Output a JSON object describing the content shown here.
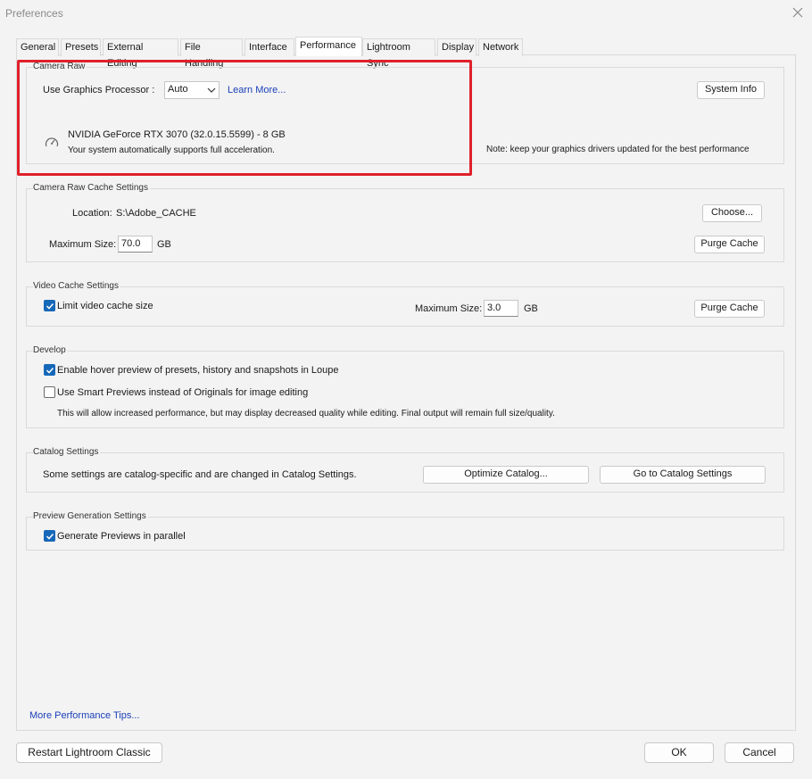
{
  "window": {
    "title": "Preferences"
  },
  "tabs": [
    {
      "label": "General"
    },
    {
      "label": "Presets"
    },
    {
      "label": "External Editing"
    },
    {
      "label": "File Handling"
    },
    {
      "label": "Interface"
    },
    {
      "label": "Performance"
    },
    {
      "label": "Lightroom Sync"
    },
    {
      "label": "Display"
    },
    {
      "label": "Network"
    }
  ],
  "camera_raw": {
    "legend": "Camera Raw",
    "gpu_label": "Use Graphics Processor :",
    "gpu_value": "Auto",
    "learn_more": "Learn More...",
    "system_info": "System Info",
    "gpu_name": "NVIDIA GeForce RTX 3070 (32.0.15.5599) - 8 GB",
    "gpu_status": "Your system automatically supports full acceleration.",
    "note": "Note: keep your graphics drivers updated for the best performance"
  },
  "cache": {
    "legend": "Camera Raw Cache Settings",
    "location_label": "Location:",
    "location_value": "S:\\Adobe_CACHE",
    "choose": "Choose...",
    "max_label": "Maximum Size:",
    "max_value": "70.0",
    "unit": "GB",
    "purge": "Purge Cache"
  },
  "video_cache": {
    "legend": "Video Cache Settings",
    "limit_label": "Limit video cache size",
    "limit_checked": true,
    "max_label": "Maximum Size:",
    "max_value": "3.0",
    "unit": "GB",
    "purge": "Purge Cache"
  },
  "develop": {
    "legend": "Develop",
    "hover_label": "Enable hover preview of presets, history and snapshots in Loupe",
    "hover_checked": true,
    "smart_label": "Use Smart Previews instead of Originals for image editing",
    "smart_checked": false,
    "smart_note": "This will allow increased performance, but may display decreased quality while editing. Final output will remain full size/quality."
  },
  "catalog": {
    "legend": "Catalog Settings",
    "text": "Some settings are catalog-specific and are changed in Catalog Settings.",
    "optimize": "Optimize Catalog...",
    "goto": "Go to Catalog Settings"
  },
  "preview": {
    "legend": "Preview Generation Settings",
    "parallel_label": "Generate Previews in parallel",
    "parallel_checked": true
  },
  "footer": {
    "tips_link": "More Performance Tips...",
    "restart": "Restart Lightroom Classic",
    "ok": "OK",
    "cancel": "Cancel"
  },
  "colors": {
    "accent_checkbox": "#1668b8",
    "link": "#1a3fb8",
    "highlight_box": "#e0202a"
  },
  "icons": {
    "close": "close-icon",
    "gpu": "gauge-icon",
    "dropdown": "chevron-down-icon",
    "checkmark": "checkmark-icon"
  }
}
